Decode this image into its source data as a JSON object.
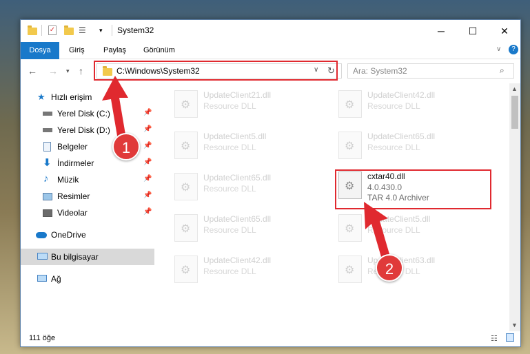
{
  "window": {
    "title": "System32"
  },
  "ribbon": {
    "tabs": [
      "Dosya",
      "Giriş",
      "Paylaş",
      "Görünüm"
    ]
  },
  "address": {
    "path": "C:\\Windows\\System32"
  },
  "search": {
    "placeholder": "Ara: System32"
  },
  "nav": {
    "items": [
      {
        "label": "Hızlı erişim",
        "icon": "star-icon"
      },
      {
        "label": "Yerel Disk (C:)",
        "icon": "drive-icon"
      },
      {
        "label": "Yerel Disk (D:)",
        "icon": "drive-icon"
      },
      {
        "label": "Belgeler",
        "icon": "document-icon"
      },
      {
        "label": "İndirmeler",
        "icon": "download-icon"
      },
      {
        "label": "Müzik",
        "icon": "music-icon"
      },
      {
        "label": "Resimler",
        "icon": "pictures-icon"
      },
      {
        "label": "Videolar",
        "icon": "video-icon"
      },
      {
        "label": "OneDrive",
        "icon": "cloud-icon"
      },
      {
        "label": "Bu bilgisayar",
        "icon": "computer-icon"
      },
      {
        "label": "Ağ",
        "icon": "network-icon"
      }
    ]
  },
  "files": {
    "left": [
      {
        "name": "UpdateClient21.dll",
        "desc": "Resource DLL"
      },
      {
        "name": "UpdateClient5.dll",
        "desc": "Resource DLL"
      },
      {
        "name": "UpdateClient65.dll",
        "desc": "Resource DLL"
      },
      {
        "name": "UpdateClient65.dll",
        "desc": "Resource DLL"
      },
      {
        "name": "UpdateClient42.dll",
        "desc": "Resource DLL"
      }
    ],
    "right": [
      {
        "name": "UpdateClient42.dll",
        "desc": "Resource DLL"
      },
      {
        "name": "UpdateClient65.dll",
        "desc": "Resource DLL"
      },
      {
        "name": "cxtar40.dll",
        "version": "4.0.430.0",
        "desc": "TAR 4.0 Archiver"
      },
      {
        "name": "UpdateClient5.dll",
        "desc": "Resource DLL"
      },
      {
        "name": "UpdateClient63.dll",
        "desc": "Resource DLL"
      }
    ]
  },
  "status": {
    "count": "111 öğe"
  },
  "annotations": {
    "step1": "1",
    "step2": "2"
  },
  "colors": {
    "accent": "#1979ca",
    "annotation": "#e0292f"
  }
}
